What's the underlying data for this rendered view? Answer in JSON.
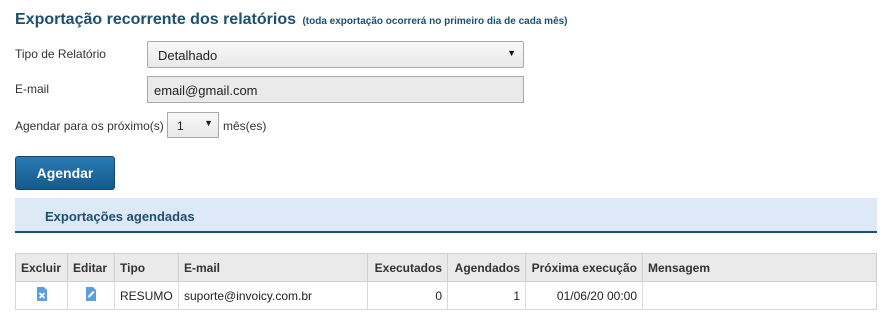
{
  "header": {
    "title": "Exportação recorrente dos relatórios",
    "subtitle": "(toda exportação ocorrerá no primeiro dia de cada mês)"
  },
  "form": {
    "report_type_label": "Tipo de Relatório",
    "report_type_value": "Detalhado",
    "email_label": "E-mail",
    "email_value": "email@gmail.com",
    "schedule_label": "Agendar para os próximo(s)",
    "months_value": "1",
    "months_suffix": "mês(es)",
    "submit_label": "Agendar"
  },
  "section": {
    "title": "Exportações agendadas"
  },
  "table": {
    "columns": [
      "Excluir",
      "Editar",
      "Tipo",
      "E-mail",
      "Executados",
      "Agendados",
      "Próxima execução",
      "Mensagem"
    ],
    "rows": [
      {
        "tipo": "RESUMO",
        "email": "suporte@invoicy.com.br",
        "executados": "0",
        "agendados": "1",
        "proxima_execucao": "01/06/20 00:00",
        "mensagem": ""
      }
    ]
  },
  "icons": {
    "delete": "delete-doc-icon",
    "edit": "edit-doc-icon",
    "dropdown": "chevron-down-icon"
  },
  "colors": {
    "heading": "#1d4f6e",
    "button": "#1f6aa0",
    "section_bg": "#dde9f7",
    "icon": "#5ba0dc"
  }
}
